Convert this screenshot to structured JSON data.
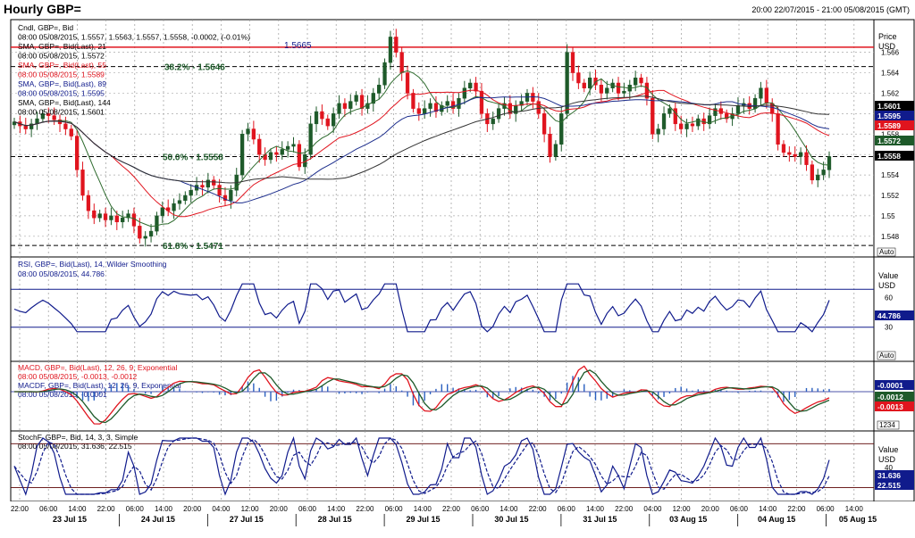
{
  "title": "Hourly GBP=",
  "date_range": "20:00 22/07/2015 - 21:00 05/08/2015 (GMT)",
  "colors": {
    "price_axis_bg": "#ffffff",
    "up_candle": "#1e5a2a",
    "down_candle": "#e0141e",
    "sma21": "#2e6b2e",
    "sma55": "#e0141e",
    "sma89": "#1c2d8c",
    "sma144": "#333333",
    "rsi": "#101b8c",
    "macd": "#e0141e",
    "macd_signal": "#1e5a2a",
    "macd_hist": "#2a5fbf",
    "stoch_k": "#101b8c",
    "stoch_d": "#101b8c",
    "fib": "#1e5a2a",
    "resistance": "#e0141e",
    "grid": "#888888"
  },
  "panels": {
    "price": {
      "legend": [
        {
          "text": "Cndl, GBP=, Bid",
          "color": "#000000"
        },
        {
          "text": "08:00 05/08/2015, 1.5557, 1.5563, 1.5557, 1.5558, -0.0002, (-0.01%)",
          "color": "#000000"
        },
        {
          "text": "SMA, GBP=, Bid(Last), 21",
          "color": "#000000"
        },
        {
          "text": "08:00 05/08/2015, 1.5572",
          "color": "#000000"
        },
        {
          "text": "SMA, GBP=, Bid(Last), 55",
          "color": "#e0141e"
        },
        {
          "text": "08:00 05/08/2015, 1.5589",
          "color": "#e0141e"
        },
        {
          "text": "SMA, GBP=, Bid(Last), 89",
          "color": "#101b8c"
        },
        {
          "text": "08:00 05/08/2015, 1.5595",
          "color": "#101b8c"
        },
        {
          "text": "SMA, GBP=, Bid(Last), 144",
          "color": "#000000"
        },
        {
          "text": "08:00 05/08/2015, 1.5601",
          "color": "#000000"
        }
      ],
      "axis_title": [
        "Price",
        "USD"
      ],
      "ticks": [
        "1.566",
        "1.564",
        "1.562",
        "1.56",
        "1.558",
        "1.556",
        "1.554",
        "1.552",
        "1.55",
        "1.548"
      ],
      "annotations": {
        "resistance": "1.5665",
        "fib382": "38.2% - 1.5646",
        "fib500": "50.0% - 1.5558",
        "fib618": "61.8% - 1.5471"
      },
      "badges": [
        {
          "text": "1.5601",
          "bg": "#000000",
          "fg": "#ffffff"
        },
        {
          "text": "1.5595",
          "bg": "#101b8c",
          "fg": "#ffffff"
        },
        {
          "text": "1.5589",
          "bg": "#e0141e",
          "fg": "#ffffff"
        },
        {
          "text": "1.5572",
          "bg": "#1e5a2a",
          "fg": "#ffffff"
        },
        {
          "text": "1.5558",
          "bg": "#000000",
          "fg": "#ffffff"
        }
      ],
      "auto": "Auto"
    },
    "rsi": {
      "legend": [
        {
          "text": "RSI, GBP=, Bid(Last), 14, Wilder Smoothing",
          "color": "#101b8c"
        },
        {
          "text": "08:00 05/08/2015, 44.786",
          "color": "#101b8c"
        }
      ],
      "axis_title": [
        "Value",
        "USD"
      ],
      "ticks": [
        "60",
        "30"
      ],
      "badge": "44.786",
      "auto": "Auto"
    },
    "macd": {
      "legend": [
        {
          "text": "MACD, GBP=, Bid(Last), 12, 26, 9, Exponential",
          "color": "#e0141e"
        },
        {
          "text": "08:00 05/08/2015, -0.0013, -0.0012",
          "color": "#e0141e"
        },
        {
          "text": "MACDF, GBP=, Bid(Last), 12, 26, 9, Exponential",
          "color": "#101b8c"
        },
        {
          "text": "08:00 05/08/2015, -0.0001",
          "color": "#101b8c"
        }
      ],
      "badges": [
        {
          "text": "-0.0001",
          "bg": "#101b8c",
          "fg": "#ffffff"
        },
        {
          "text": "-0.0012",
          "bg": "#1e5a2a",
          "fg": "#ffffff"
        },
        {
          "text": "-0.0013",
          "bg": "#e0141e",
          "fg": "#ffffff"
        }
      ],
      "unit": "1234"
    },
    "stoch": {
      "legend": [
        {
          "text": "StochF, GBP=, Bid, 14, 3, 3, Simple",
          "color": "#000000"
        },
        {
          "text": "08:00 05/08/2015, 31.636, 22.515",
          "color": "#000000"
        }
      ],
      "axis_title": [
        "Value",
        "USD"
      ],
      "tick": "40",
      "badges": [
        {
          "text": "31.636",
          "bg": "#101b8c",
          "fg": "#ffffff"
        },
        {
          "text": "22.515",
          "bg": "#101b8c",
          "fg": "#ffffff"
        }
      ]
    }
  },
  "xaxis": {
    "hours": [
      "22:00",
      "06:00",
      "14:00",
      "22:00",
      "06:00",
      "14:00",
      "20:00",
      "04:00",
      "12:00",
      "20:00",
      "06:00",
      "14:00",
      "22:00",
      "06:00",
      "14:00",
      "22:00",
      "06:00",
      "14:00",
      "22:00",
      "06:00",
      "14:00",
      "22:00",
      "04:00",
      "12:00",
      "20:00",
      "06:00",
      "14:00",
      "22:00",
      "06:00",
      "14:00"
    ],
    "days": [
      "23 Jul 15",
      "24 Jul 15",
      "27 Jul 15",
      "28 Jul 15",
      "29 Jul 15",
      "30 Jul 15",
      "31 Jul 15",
      "03 Aug 15",
      "04 Aug 15",
      "05 Aug 15"
    ]
  },
  "chart_data": {
    "type": "line",
    "title": "Hourly GBP=",
    "x_days": [
      "23 Jul 15",
      "24 Jul 15",
      "27 Jul 15",
      "28 Jul 15",
      "29 Jul 15",
      "30 Jul 15",
      "31 Jul 15",
      "03 Aug 15",
      "04 Aug 15",
      "05 Aug 15"
    ],
    "ylim": [
      1.5465,
      1.5685
    ],
    "close": [
      1.5592,
      1.5588,
      1.5585,
      1.559,
      1.5595,
      1.56,
      1.5598,
      1.5594,
      1.559,
      1.5585,
      1.5578,
      1.5545,
      1.552,
      1.5505,
      1.5498,
      1.5502,
      1.5496,
      1.55,
      1.5494,
      1.5498,
      1.5502,
      1.549,
      1.5478,
      1.548,
      1.5485,
      1.55,
      1.5508,
      1.5505,
      1.5512,
      1.5515,
      1.552,
      1.5525,
      1.553,
      1.5528,
      1.5535,
      1.553,
      1.552,
      1.5515,
      1.5525,
      1.554,
      1.558,
      1.5585,
      1.5575,
      1.556,
      1.5555,
      1.5562,
      1.556,
      1.5565,
      1.5568,
      1.557,
      1.5548,
      1.556,
      1.559,
      1.5602,
      1.5595,
      1.5588,
      1.56,
      1.561,
      1.5605,
      1.5612,
      1.5618,
      1.5605,
      1.561,
      1.562,
      1.5628,
      1.565,
      1.5675,
      1.566,
      1.564,
      1.562,
      1.5605,
      1.56,
      1.5605,
      1.561,
      1.5602,
      1.5608,
      1.5612,
      1.5605,
      1.5615,
      1.5625,
      1.563,
      1.5622,
      1.56,
      1.559,
      1.5595,
      1.5605,
      1.561,
      1.56,
      1.5608,
      1.5612,
      1.562,
      1.5612,
      1.56,
      1.558,
      1.5558,
      1.557,
      1.56,
      1.566,
      1.564,
      1.563,
      1.5625,
      1.5635,
      1.5628,
      1.562,
      1.5625,
      1.563,
      1.562,
      1.5622,
      1.5628,
      1.5635,
      1.563,
      1.5615,
      1.558,
      1.5585,
      1.56,
      1.5605,
      1.559,
      1.5585,
      1.559,
      1.5588,
      1.5595,
      1.559,
      1.5598,
      1.5605,
      1.56,
      1.5595,
      1.56,
      1.5608,
      1.561,
      1.5605,
      1.5615,
      1.5625,
      1.561,
      1.56,
      1.557,
      1.5562,
      1.556,
      1.5558,
      1.5562,
      1.555,
      1.5535,
      1.554,
      1.5545,
      1.5558
    ],
    "levels": {
      "resistance": 1.5665,
      "fib_38_2": 1.5646,
      "fib_50_0": 1.5558,
      "fib_61_8": 1.5471
    },
    "rsi_last": 44.786,
    "macd_last": [
      -0.0013,
      -0.0012,
      -0.0001
    ],
    "stoch_last": [
      31.636,
      22.515
    ]
  }
}
